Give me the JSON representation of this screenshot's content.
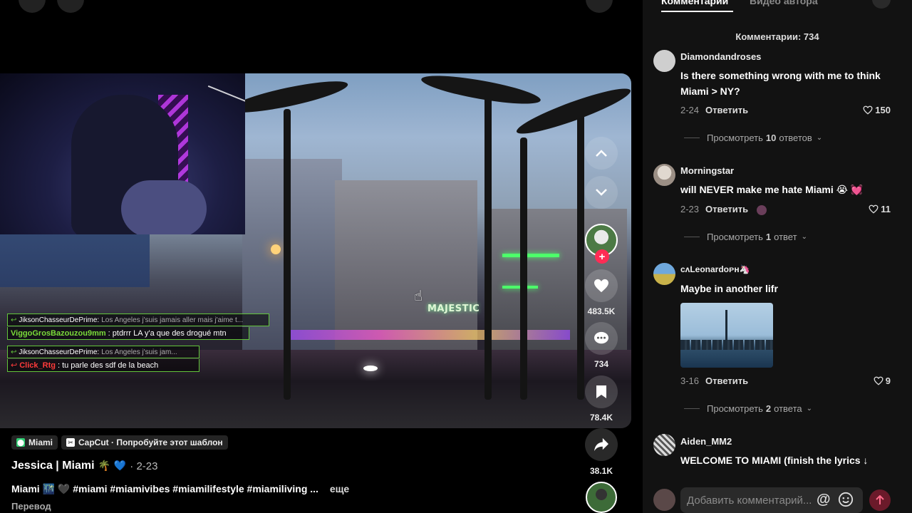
{
  "video": {
    "sign_text": "MAJESTIC",
    "chat": [
      {
        "type": "reply",
        "user": "JiksonChasseurDePrime:",
        "text": "Los Angeles j'suis jamais aller mais j'aime t..."
      },
      {
        "type": "msg",
        "user": "ViggoGrosBazouzou9mm",
        "text": ": ptdrrr LA y'a que des drogué mtn",
        "color": "#7bdc3a"
      },
      {
        "type": "reply",
        "user": "JiksonChasseurDePrime:",
        "text": "Los Angeles j'suis jam..."
      },
      {
        "type": "msg",
        "user": "Click_Rtg",
        "text": ": tu parle des sdf de la beach",
        "color": "#ff3b3b"
      }
    ]
  },
  "actions": {
    "likes": "483.5K",
    "comments": "734",
    "saves": "78.4K",
    "shares": "38.1K"
  },
  "caption": {
    "tag_location": "Miami",
    "tag_capcut": "CapCut · Попробуйте этот шаблон",
    "author": "Jessica | Miami",
    "author_emoji": "🌴 💙",
    "date": "· 2-23",
    "description": "Miami 🌃 🖤  #miami #miamivibes #miamilifestyle #miamiliving ...",
    "more": "еще",
    "translate": "Перевод"
  },
  "panel": {
    "tab_comments": "Комментарии",
    "tab_author": "Видео автора",
    "count_label": "Комментарии: 734",
    "comments": [
      {
        "user": "Diamondandroses",
        "text": "Is there something wrong with me to think Miami > NY?",
        "date": "2-24",
        "reply": "Ответить",
        "likes": "150",
        "view_prefix": "Просмотреть ",
        "view_count": "10",
        "view_suffix": " ответов"
      },
      {
        "user": "Morningstar",
        "text": "will NEVER make me hate Miami 😭 💓",
        "date": "2-23",
        "reply": "Ответить",
        "likes": "11",
        "view_prefix": "Просмотреть ",
        "view_count": "1",
        "view_suffix": " ответ"
      },
      {
        "user": "cʌLeonardoᴘʜ🦄",
        "text": "Maybe in another lifr",
        "date": "3-16",
        "reply": "Ответить",
        "likes": "9",
        "view_prefix": "Просмотреть ",
        "view_count": "2",
        "view_suffix": " ответа"
      },
      {
        "user": "Aiden_MM2",
        "text": "WELCOME TO MIAMI (finish the lyrics ↓"
      }
    ],
    "input_placeholder": "Добавить комментарий...",
    "at_symbol": "@"
  },
  "colors": {
    "accent": "#fe2c55",
    "panel_bg": "#121212",
    "chat_border": "#62c53a"
  }
}
